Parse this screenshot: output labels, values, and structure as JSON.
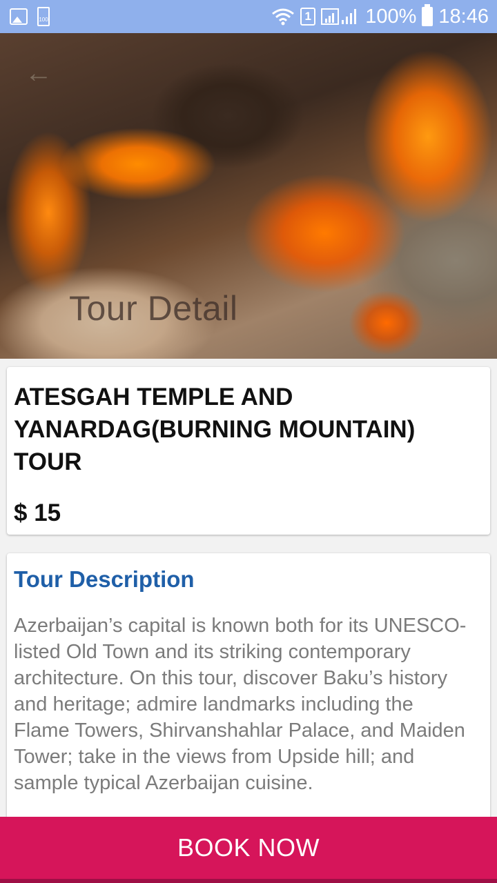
{
  "status_bar": {
    "battery_small_label": "100",
    "sim_number": "1",
    "battery_percent": "100%",
    "time": "18:46",
    "color": "#8fb0ec"
  },
  "header": {
    "title": "Tour Detail",
    "back_icon": "arrow-left-icon"
  },
  "tour": {
    "name": "ATESGAH TEMPLE AND YANARDAG(BURNING MOUNTAIN) TOUR",
    "price": "$ 15"
  },
  "description": {
    "heading": "Tour Description",
    "text": "Azerbaijan’s capital is known both for its UNESCO-listed Old Town and its striking contemporary architecture. On this tour, discover Baku’s history and heritage; admire landmarks including the Flame Towers, Shirvanshahlar Palace, and Maiden Tower; take in the views from Upside hill; and sample typical Azerbaijan cuisine."
  },
  "actions": {
    "book_label": "BOOK NOW",
    "book_color": "#d6155a"
  }
}
